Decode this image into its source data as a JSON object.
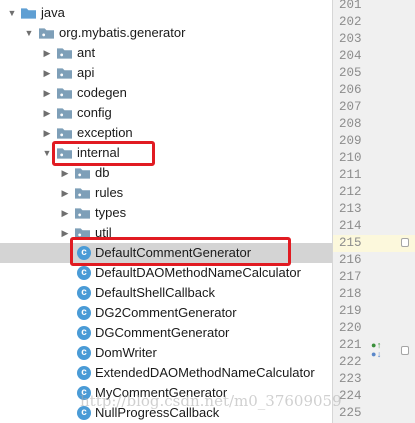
{
  "tree": {
    "java": "java",
    "package": "org.mybatis.generator",
    "folders": [
      "ant",
      "api",
      "codegen",
      "config",
      "exception"
    ],
    "internal": "internal",
    "subfolders": [
      "db",
      "rules",
      "types",
      "util"
    ],
    "classes": [
      "DefaultCommentGenerator",
      "DefaultDAOMethodNameCalculator",
      "DefaultShellCallback",
      "DG2CommentGenerator",
      "DGCommentGenerator",
      "DomWriter",
      "ExtendedDAOMethodNameCalculator",
      "MyCommentGenerator",
      "NullProgressCallback"
    ],
    "class_icon_letter": "c",
    "selected_class": "DefaultCommentGenerator"
  },
  "gutter": {
    "lines": [
      "201",
      "202",
      "203",
      "204",
      "205",
      "206",
      "207",
      "208",
      "209",
      "210",
      "211",
      "212",
      "213",
      "214",
      "215",
      "216",
      "217",
      "218",
      "219",
      "220",
      "221",
      "222",
      "223",
      "224",
      "225"
    ],
    "current_line": "215",
    "markers_line": "221"
  },
  "watermark": "http://blog.csdn.net/m0_37609059",
  "colors": {
    "highlight_box": "#e11b22",
    "selection": "#d4d4d4",
    "folder": "#7e9fb8",
    "class_icon": "#4a9bd6",
    "gutter_bg": "#f0f0f0"
  }
}
